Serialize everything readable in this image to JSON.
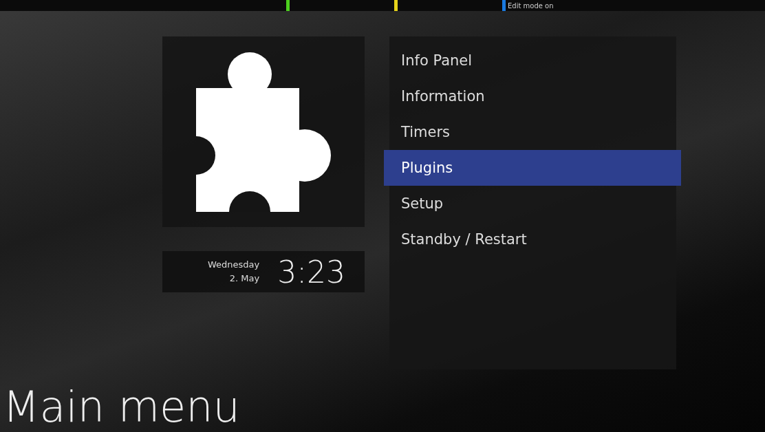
{
  "color_keys": [
    {
      "color": "#4ccf1e"
    },
    {
      "color": "#e5d21a"
    },
    {
      "color": "#1a7ae0",
      "label": "Edit mode on"
    }
  ],
  "clock": {
    "day": "Wednesday",
    "date": "2. May",
    "time": "3:23"
  },
  "menu": {
    "items": [
      {
        "label": "Info Panel",
        "selected": false
      },
      {
        "label": "Information",
        "selected": false
      },
      {
        "label": "Timers",
        "selected": false
      },
      {
        "label": "Plugins",
        "selected": true
      },
      {
        "label": "Setup",
        "selected": false
      },
      {
        "label": "Standby / Restart",
        "selected": false
      }
    ]
  },
  "title": "Main menu"
}
